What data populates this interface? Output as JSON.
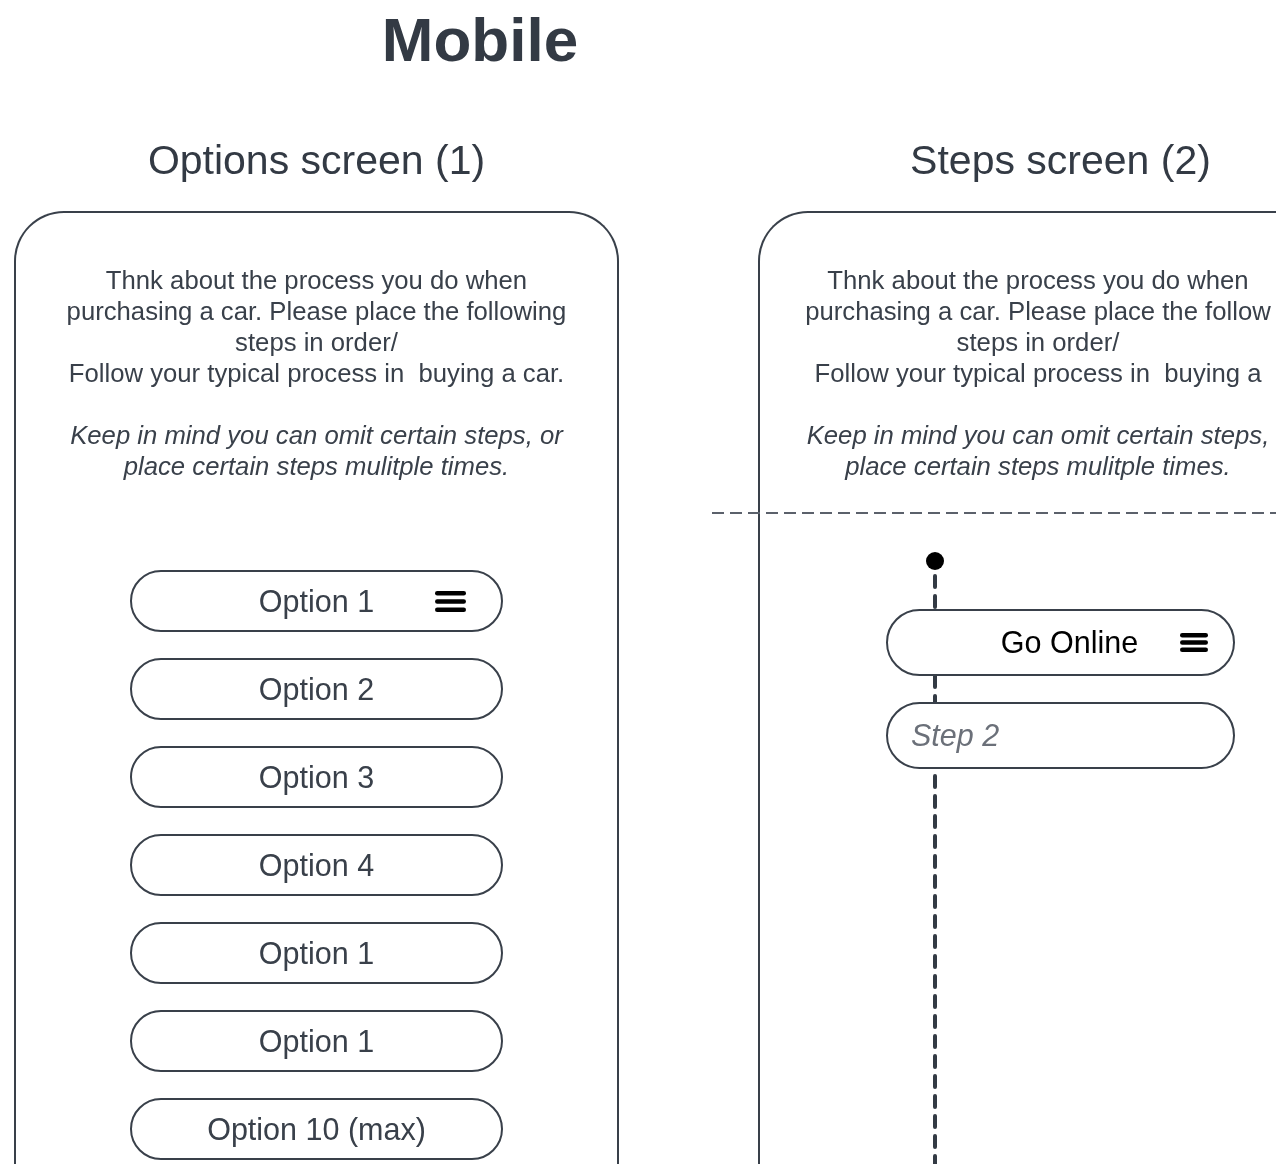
{
  "title": "Mobile",
  "screens": [
    {
      "kind": "options",
      "heading": "Options screen (1)",
      "instructions": "Thnk about the process you do when purchasing a car. Please place the following steps in order/\nFollow your typical process in  buying a car.",
      "note": "Keep in mind you can omit certain steps, or place certain steps mulitple times.",
      "options": [
        {
          "label": "Option 1",
          "handle": true
        },
        {
          "label": "Option 2",
          "handle": false
        },
        {
          "label": "Option 3",
          "handle": false
        },
        {
          "label": "Option 4",
          "handle": false
        },
        {
          "label": "Option 1",
          "handle": false
        },
        {
          "label": "Option 1",
          "handle": false
        },
        {
          "label": "Option 10 (max)",
          "handle": false
        }
      ]
    },
    {
      "kind": "steps",
      "heading": "Steps screen (2)",
      "instructions": "Thnk about the process you do when\npurchasing a car. Please place the follow\nsteps in order/\nFollow your typical process in  buying a",
      "note": "Keep in mind you can omit certain steps,\nplace certain steps mulitple times.",
      "steps": [
        {
          "kind": "filled",
          "label": "Go Online"
        },
        {
          "kind": "empty",
          "placeholder": "Step 2"
        }
      ]
    }
  ]
}
